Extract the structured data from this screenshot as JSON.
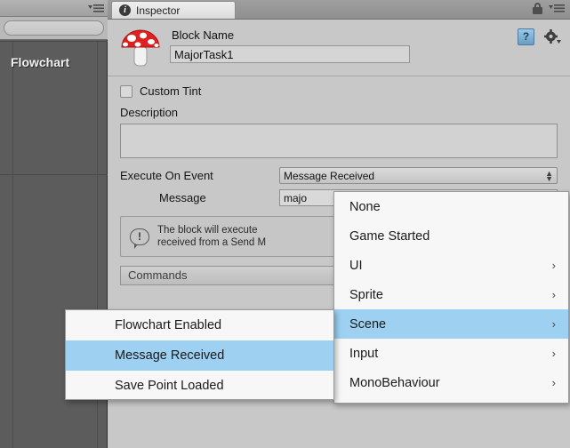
{
  "left_panel": {
    "search": {
      "value": "",
      "placeholder": ""
    },
    "clear_icon": "clear-icon",
    "menu_icon": "hamburger-menu-icon",
    "title": "Flowchart"
  },
  "inspector": {
    "tab_label": "Inspector",
    "tab_icon": "info-circle-icon",
    "lock_icon": "lock-icon",
    "menu_icon": "hamburger-menu-icon",
    "help_icon": "help-book-icon",
    "help_glyph": "?",
    "gear_icon": "gear-icon",
    "object_icon": "mushroom-icon",
    "block_name_label": "Block Name",
    "block_name_value": "MajorTask1",
    "custom_tint_label": "Custom Tint",
    "custom_tint_checked": false,
    "description_label": "Description",
    "description_value": "",
    "execute_on_event_label": "Execute On Event",
    "execute_on_event_value": "Message Received",
    "message_label": "Message",
    "message_value": "majo",
    "info_glyph": "!",
    "info_line1": "The block will execute",
    "info_line2": "received from a Send M",
    "commands_label": "Commands"
  },
  "event_menu": {
    "items": [
      {
        "label": "None",
        "submenu": false,
        "selected": false
      },
      {
        "label": "Game Started",
        "submenu": false,
        "selected": false
      },
      {
        "label": "UI",
        "submenu": true,
        "selected": false
      },
      {
        "label": "Sprite",
        "submenu": true,
        "selected": false
      },
      {
        "label": "Scene",
        "submenu": true,
        "selected": true
      },
      {
        "label": "Input",
        "submenu": true,
        "selected": false
      },
      {
        "label": "MonoBehaviour",
        "submenu": true,
        "selected": false
      }
    ],
    "chevron": "›"
  },
  "scene_submenu": {
    "items": [
      {
        "label": "Flowchart Enabled",
        "selected": false
      },
      {
        "label": "Message Received",
        "selected": true
      },
      {
        "label": "Save Point Loaded",
        "selected": false
      }
    ]
  },
  "colors": {
    "highlight": "#9ed0f2",
    "panel_bg": "#c8c8c8",
    "left_bg": "#5c5c5c",
    "menu_bg": "#f7f7f7"
  }
}
